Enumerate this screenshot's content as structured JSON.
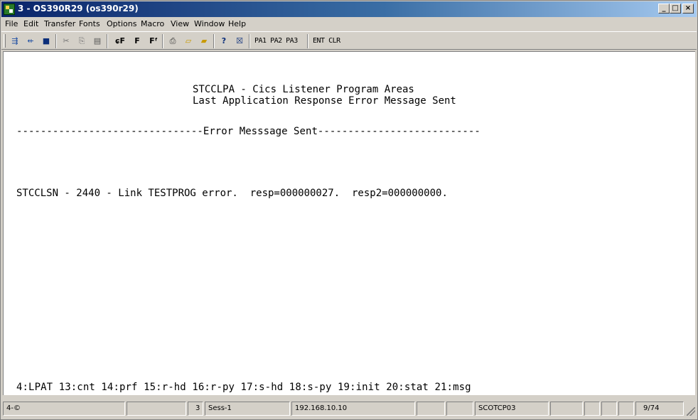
{
  "window": {
    "title": "3 - OS390R29 (os390r29)"
  },
  "caption_buttons": {
    "minimize": "_",
    "maximize": "□",
    "close": "×"
  },
  "menu": {
    "file": "File",
    "edit": "Edit",
    "transfer": "Transfer",
    "fonts": "Fonts",
    "options": "Options",
    "macro": "Macro",
    "view": "View",
    "window": "Window",
    "help": "Help"
  },
  "toolbar": {
    "icons": {
      "send": "⇶",
      "receive": "⇷",
      "save": "■",
      "cut": "✂",
      "copy": "⎘",
      "paste": "▤",
      "font_large": "ɕF",
      "font_medium": "F",
      "font_small": "Fᶠ",
      "print": "⎙",
      "open_file": "▱",
      "send_file": "▰",
      "help": "?",
      "stop": "☒"
    },
    "pa_keys": "PA1 PA2 PA3",
    "ent_clr": "ENT CLR"
  },
  "screen": {
    "title_line1": "STCCLPA - Cics Listener Program Areas",
    "title_line2": "Last Application Response Error Message Sent",
    "separator": "-------------------------------Error Messsage Sent---------------------------",
    "error_line": "STCCLSN - 2440 - Link TESTPROG error.  resp=000000027.  resp2=000000000.",
    "pf_keys": "4:LPAT 13:cnt 14:prf 15:r-hd 16:r-py 17:s-hd 18:s-py 19:init 20:stat 21:msg"
  },
  "status": {
    "indicator": "4-©",
    "session_num": "3",
    "session_name": "Sess-1",
    "ip": "192.168.10.10",
    "lu_name": "SCOTCP03",
    "cursor": "9/74"
  }
}
